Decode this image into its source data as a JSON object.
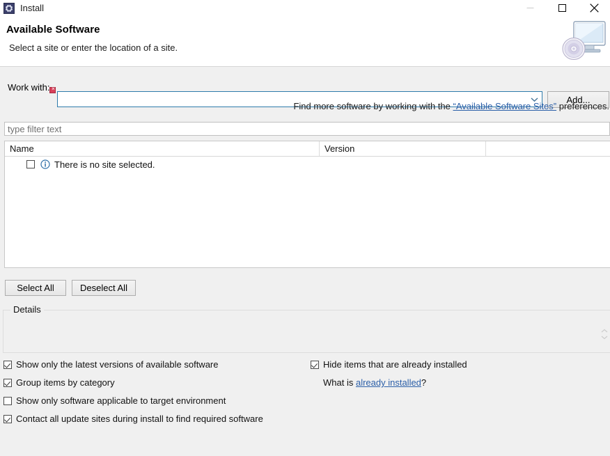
{
  "window": {
    "title": "Install",
    "icon": "install-wizard-icon",
    "buttons": {
      "minimize": "minimize-icon",
      "maximize": "maximize-icon",
      "close": "close-icon"
    }
  },
  "banner": {
    "title": "Available Software",
    "subtitle": "Select a site or enter the location of a site.",
    "art": "computer-with-disc-icon"
  },
  "work_with": {
    "label": "Work with:",
    "value": "",
    "placeholder": "",
    "error_badge": "error-decoration-icon",
    "error_badge_glyph": "×",
    "dropdown_icon": "chevron-down-icon",
    "add_button": "Add..."
  },
  "find_line": {
    "prefix": "Find more software by working with the ",
    "link": "“Available Software Sites”",
    "suffix": " preferences."
  },
  "filter": {
    "value": "",
    "placeholder": "type filter text"
  },
  "table": {
    "columns": [
      "Name",
      "Version",
      ""
    ],
    "rows": [
      {
        "checked": false,
        "icon": "info-icon",
        "name": "There is no site selected.",
        "version": ""
      }
    ]
  },
  "selection_buttons": {
    "select_all": "Select All",
    "deselect_all": "Deselect All"
  },
  "details": {
    "legend": "Details",
    "content": "",
    "scroll_icon": "scroll-spinner-icon"
  },
  "options": {
    "left": [
      {
        "label": "Show only the latest versions of available software",
        "checked": true
      },
      {
        "label": "Group items by category",
        "checked": true
      },
      {
        "label": "Show only software applicable to target environment",
        "checked": false
      },
      {
        "label": "Contact all update sites during install to find required software",
        "checked": true
      }
    ],
    "right": [
      {
        "label": "Hide items that are already installed",
        "checked": true
      }
    ],
    "what_is": {
      "prefix": "What is ",
      "link": "already installed",
      "suffix": "?"
    }
  },
  "colors": {
    "dialog_bg": "#f0f0f0",
    "header_bg": "#ffffff",
    "focus_border": "#2e7bab",
    "link": "#2b5fa8",
    "error": "#d9415a",
    "info": "#2f6fa8"
  }
}
